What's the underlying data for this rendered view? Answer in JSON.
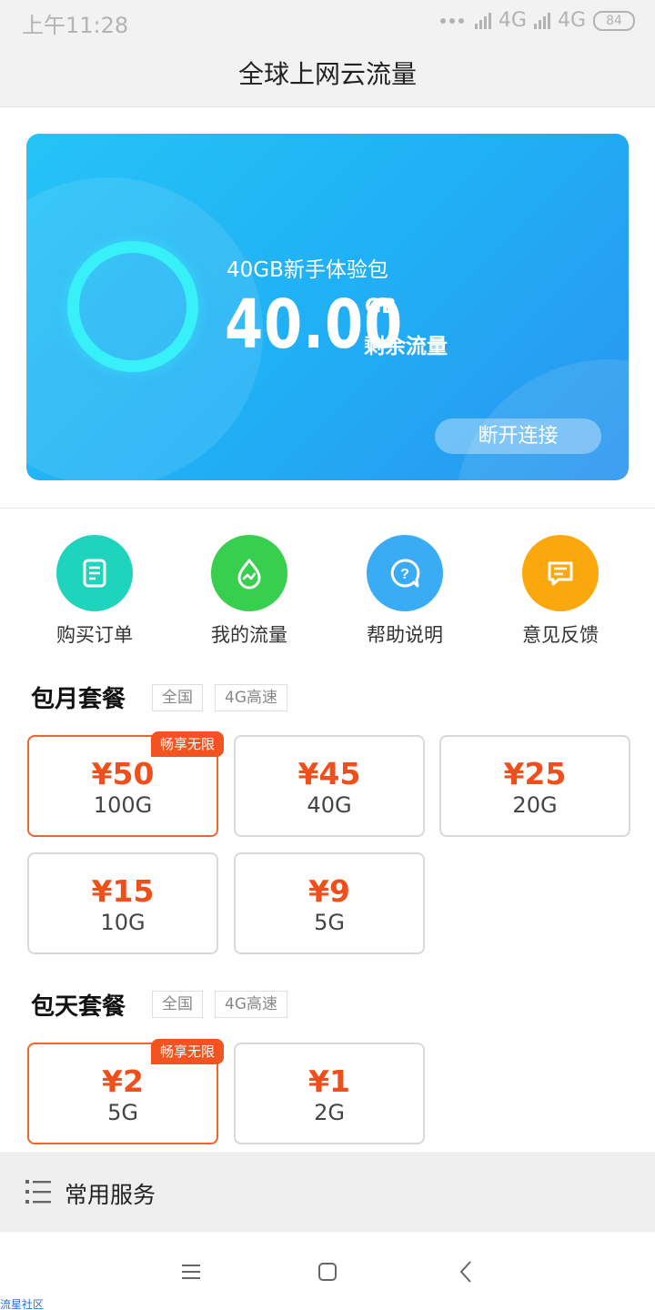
{
  "status_bar": {
    "time": "上午11:28",
    "network1": "4G",
    "network2": "4G",
    "battery": "84"
  },
  "header": {
    "title": "全球上网云流量"
  },
  "hero": {
    "package_name": "40GB新手体验包",
    "remaining_value": "40.00",
    "remaining_unit": "GB",
    "remaining_label": "剩余流量",
    "disconnect_label": "断开连接",
    "ring_color": "#38f0f8"
  },
  "quick_actions": [
    {
      "label": "购买订单",
      "icon": "document-icon",
      "color": "#1fd4bc"
    },
    {
      "label": "我的流量",
      "icon": "droplet-chart-icon",
      "color": "#38cf4e"
    },
    {
      "label": "帮助说明",
      "icon": "help-bubble-icon",
      "color": "#3aabf5"
    },
    {
      "label": "意见反馈",
      "icon": "feedback-bubble-icon",
      "color": "#fba80f"
    }
  ],
  "monthly": {
    "title": "包月套餐",
    "tags": [
      "全国",
      "4G高速"
    ],
    "badge": "畅享无限",
    "plans": [
      {
        "price": "¥50",
        "data": "100G"
      },
      {
        "price": "¥45",
        "data": "40G"
      },
      {
        "price": "¥25",
        "data": "20G"
      },
      {
        "price": "¥15",
        "data": "10G"
      },
      {
        "price": "¥9",
        "data": "5G"
      }
    ]
  },
  "daily": {
    "title": "包天套餐",
    "tags": [
      "全国",
      "4G高速"
    ],
    "badge": "畅享无限",
    "plans": [
      {
        "price": "¥2",
        "data": "5G"
      },
      {
        "price": "¥1",
        "data": "2G"
      }
    ]
  },
  "services": {
    "label": "常用服务"
  },
  "watermark": "流星社区",
  "colors": {
    "accent": "#ef4f1c",
    "selected_border": "#f0652c",
    "hero_start": "#25c3f6",
    "hero_end": "#2a94ef"
  }
}
